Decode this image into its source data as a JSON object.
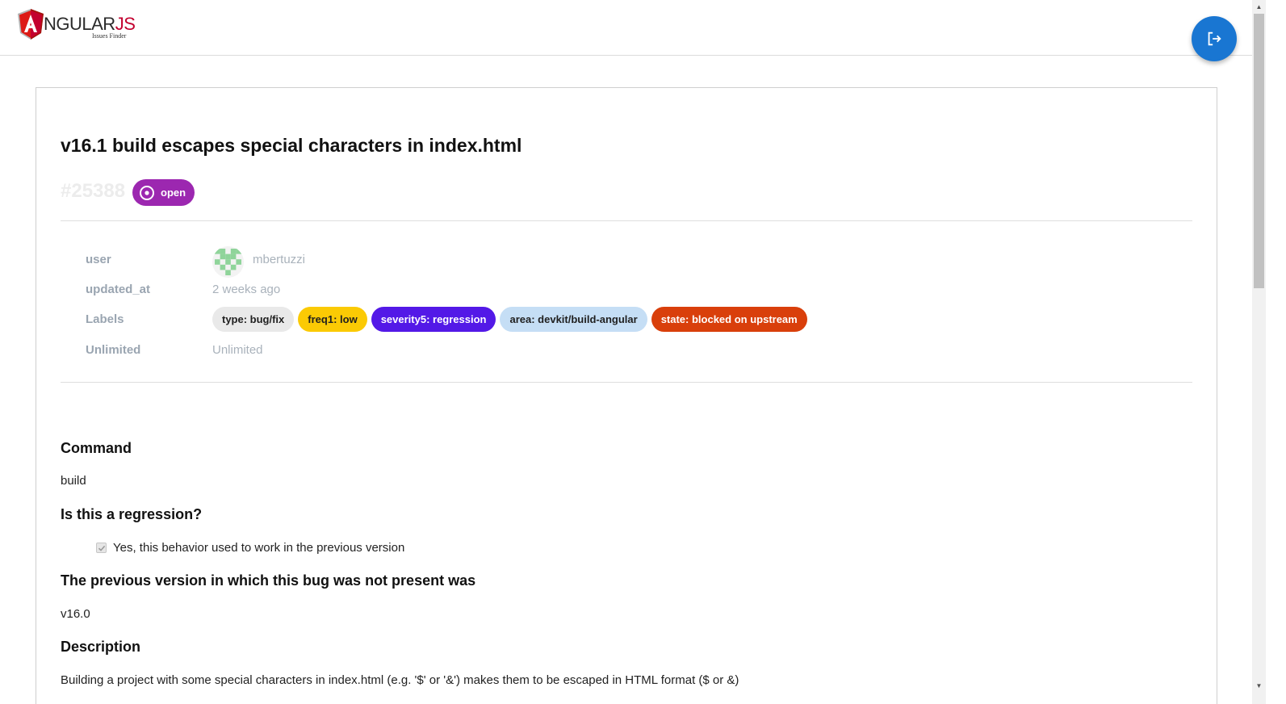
{
  "header": {
    "logo_word_main": "NGULAR",
    "logo_word_accent": "JS",
    "logo_letter": "A",
    "logo_subtitle": "Issues Finder",
    "logout_icon": "logout-icon"
  },
  "issue": {
    "title": "v16.1 build escapes special characters in index.html",
    "number": "#25388",
    "state": "open",
    "state_color": "#9c27b0"
  },
  "meta": {
    "user_label": "user",
    "user_value": "mbertuzzi",
    "updated_label": "updated_at",
    "updated_value": "2 weeks ago",
    "labels_label": "Labels",
    "unlimited_label": "Unlimited",
    "unlimited_value": "Unlimited"
  },
  "labels": [
    {
      "text": "type: bug/fix",
      "bg": "#e9e9e9",
      "fg": "#1f1f1f"
    },
    {
      "text": "freq1: low",
      "bg": "#fbca04",
      "fg": "#1f1f1f"
    },
    {
      "text": "severity5: regression",
      "bg": "#5319e7",
      "fg": "#ffffff"
    },
    {
      "text": "area: devkit/build-angular",
      "bg": "#c5def5",
      "fg": "#1f1f1f"
    },
    {
      "text": "state: blocked on upstream",
      "bg": "#d93f0b",
      "fg": "#ffffff"
    }
  ],
  "body": {
    "command_heading": "Command",
    "command_value": "build",
    "regression_heading": "Is this a regression?",
    "regression_checkbox_label": "Yes, this behavior used to work in the previous version",
    "regression_checked": true,
    "previous_version_heading": "The previous version in which this bug was not present was",
    "previous_version_value": "v16.0",
    "description_heading": "Description",
    "description_text": "Building a project with some special characters in index.html (e.g. '$' or '&') makes them to be escaped in HTML format ($ or &)"
  },
  "colors": {
    "accent": "#1976d2",
    "logo_red": "#c3002f"
  }
}
